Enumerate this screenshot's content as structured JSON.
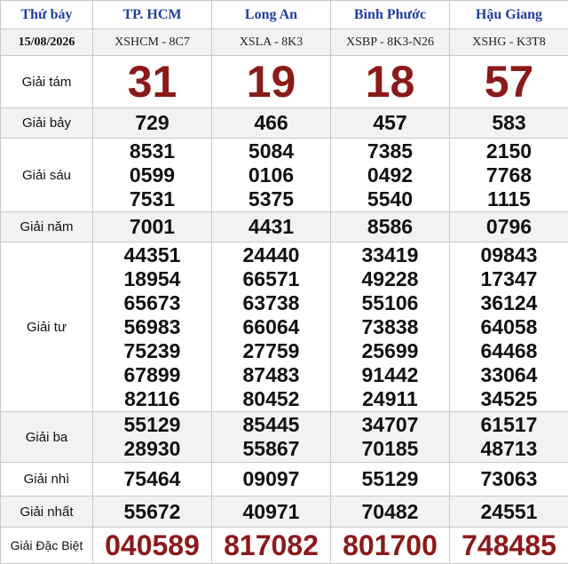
{
  "header": {
    "day": "Thứ bảy",
    "date": "15/08/2026",
    "provinces": [
      {
        "name": "TP. HCM",
        "code": "XSHCM - 8C7"
      },
      {
        "name": "Long An",
        "code": "XSLA - 8K3"
      },
      {
        "name": "Bình Phước",
        "code": "XSBP - 8K3-N26"
      },
      {
        "name": "Hậu Giang",
        "code": "XSHG - K3T8"
      }
    ]
  },
  "prizes": {
    "g8": {
      "label": "Giải tám",
      "values": [
        "31",
        "19",
        "18",
        "57"
      ]
    },
    "g7": {
      "label": "Giải bảy",
      "values": [
        "729",
        "466",
        "457",
        "583"
      ]
    },
    "g6": {
      "label": "Giải sáu",
      "values": [
        [
          "8531",
          "0599",
          "7531"
        ],
        [
          "5084",
          "0106",
          "5375"
        ],
        [
          "7385",
          "0492",
          "5540"
        ],
        [
          "2150",
          "7768",
          "1115"
        ]
      ]
    },
    "g5": {
      "label": "Giải năm",
      "values": [
        "7001",
        "4431",
        "8586",
        "0796"
      ]
    },
    "g4": {
      "label": "Giải tư",
      "values": [
        [
          "44351",
          "18954",
          "65673",
          "56983",
          "75239",
          "67899",
          "82116"
        ],
        [
          "24440",
          "66571",
          "63738",
          "66064",
          "27759",
          "87483",
          "80452"
        ],
        [
          "33419",
          "49228",
          "55106",
          "73838",
          "25699",
          "91442",
          "24911"
        ],
        [
          "09843",
          "17347",
          "36124",
          "64058",
          "64468",
          "33064",
          "34525"
        ]
      ]
    },
    "g3": {
      "label": "Giải ba",
      "values": [
        [
          "55129",
          "28930"
        ],
        [
          "85445",
          "55867"
        ],
        [
          "34707",
          "70185"
        ],
        [
          "61517",
          "48713"
        ]
      ]
    },
    "g2": {
      "label": "Giải nhì",
      "values": [
        "75464",
        "09097",
        "55129",
        "73063"
      ]
    },
    "g1": {
      "label": "Giải nhất",
      "values": [
        "55672",
        "40971",
        "70482",
        "24551"
      ]
    },
    "db": {
      "label": "Giải Đặc Biệt",
      "values": [
        "040589",
        "817082",
        "801700",
        "748485"
      ]
    }
  },
  "colors": {
    "province_header": "#1f3fa0",
    "highlight_number": "#8b1a1a",
    "stripe": "#f2f2f2",
    "border": "#c9c9c9"
  }
}
